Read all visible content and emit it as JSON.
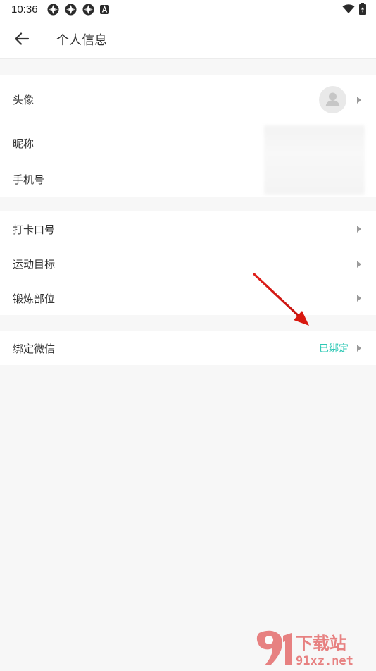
{
  "status_bar": {
    "time": "10:36",
    "left_icons": [
      "app-notification-icon",
      "app-notification-icon",
      "app-notification-icon",
      "a-badge-icon"
    ],
    "right_icons": [
      "wifi-icon",
      "battery-icon"
    ]
  },
  "header": {
    "title": "个人信息",
    "back_icon": "arrow-left-icon"
  },
  "sections": {
    "profile": {
      "avatar_label": "头像",
      "nickname_label": "昵称",
      "phone_label": "手机号"
    },
    "training": {
      "slogan_label": "打卡口号",
      "goal_label": "运动目标",
      "body_part_label": "锻炼部位"
    },
    "account": {
      "wechat_label": "绑定微信",
      "wechat_status": "已绑定"
    }
  },
  "watermark": {
    "brand_number": "9",
    "brand_text": "下载站",
    "domain": "91xz.net"
  },
  "colors": {
    "accent": "#2ec8b5",
    "annotation_arrow": "#e0201b",
    "background": "#f7f7f7"
  }
}
